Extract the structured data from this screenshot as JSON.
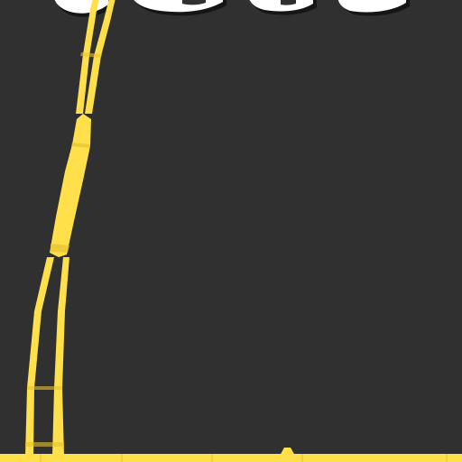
{
  "viewport": {
    "background_color": "#303030"
  },
  "title_glyphs": {
    "fill_color": "#ffffff",
    "outline_color": "#2a2a2a",
    "shadow_color": "#151515",
    "note": ""
  },
  "colors": {
    "stroke_yellow": "#ffe04a",
    "stroke_yellow_shade": "#e6c12f"
  },
  "icons": {
    "graph_strokes": "stroke-path-icon",
    "baseline": "ground-line-icon",
    "marker": "peak-marker-icon"
  }
}
